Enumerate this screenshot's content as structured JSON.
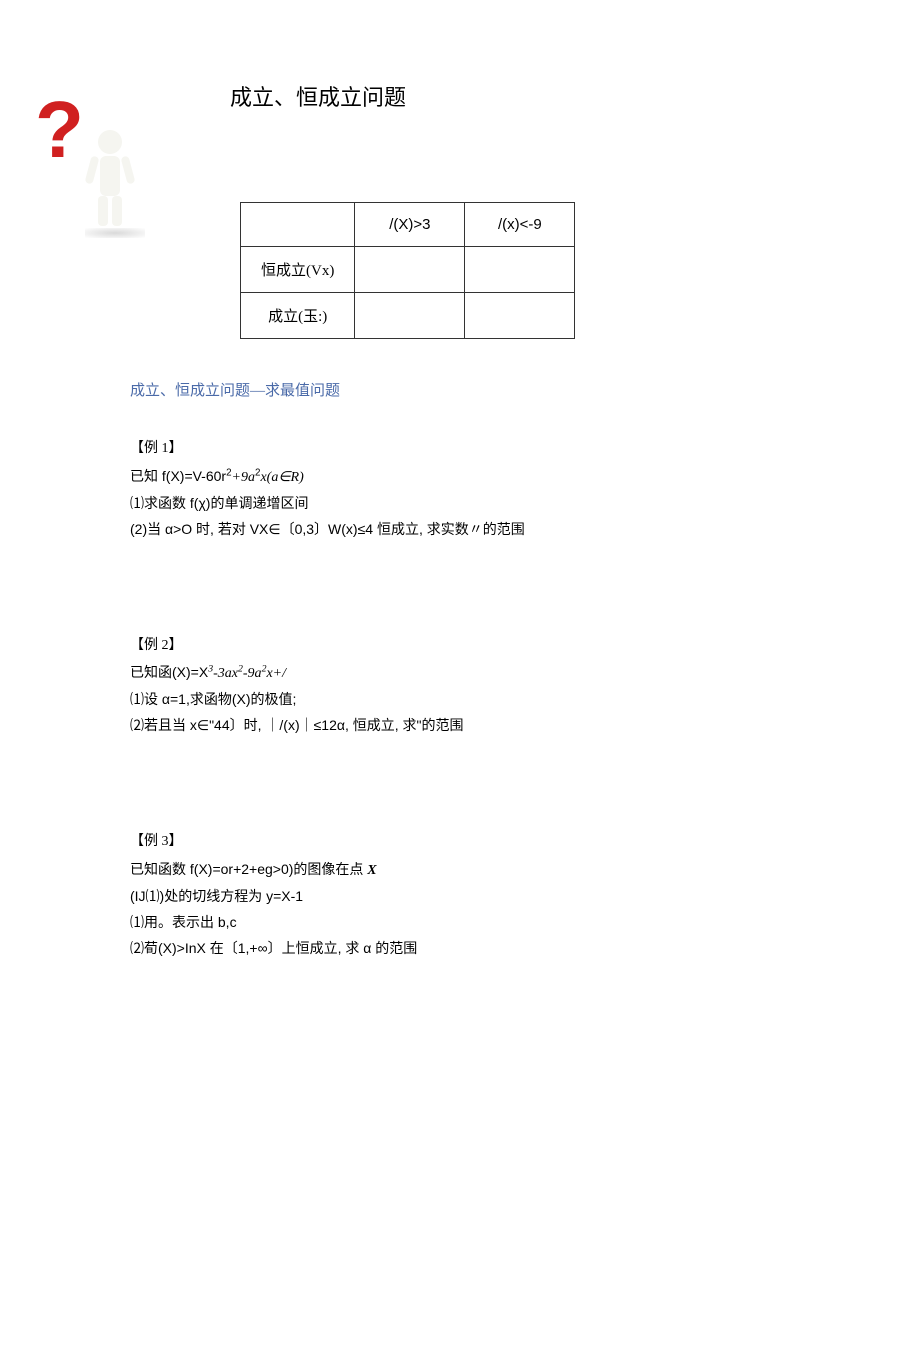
{
  "title": "成立、恒成立问题",
  "table": {
    "col1": "/(X)>3",
    "col2": "/(x)<-9",
    "row1": "恒成立(Vx)",
    "row2": "成立(玉:)"
  },
  "section_title": "成立、恒成立问题—求最值问题",
  "examples": {
    "ex1": {
      "label": "【例 1】",
      "line1_prefix": "已知 f(X)=V-60r",
      "line1_mid": "+9a",
      "line1_suffix": "x(a∈R)",
      "line2": "⑴求函数 f(χ)的单调递增区间",
      "line3": "(2)当 α>O 时, 若对 VX∈〔0,3〕W(x)≤4 恒成立, 求实数〃的范围"
    },
    "ex2": {
      "label": "【例 2】",
      "line1_prefix": "已知函(X)=X",
      "line1_mid1": "-3ax",
      "line1_mid2": "-9a",
      "line1_suffix": "x+/",
      "line2": "⑴设 α=1,求函物(X)的极值;",
      "line3": "⑵若且当 x∈\"44〕时, ｜/(x)｜≤12α, 恒成立, 求\"的范围"
    },
    "ex3": {
      "label": "【例 3】",
      "line1_prefix": "已知函数 f(X)=or+2+eg>0)的图像在点 ",
      "line1_emX": "X",
      "line2": "(IJ⑴)处的切线方程为 y=X-1",
      "line3": "⑴用。表示出 b,c",
      "line4": "⑵荀(X)>InX 在〔1,+∞〕上恒成立, 求 α 的范围"
    }
  }
}
